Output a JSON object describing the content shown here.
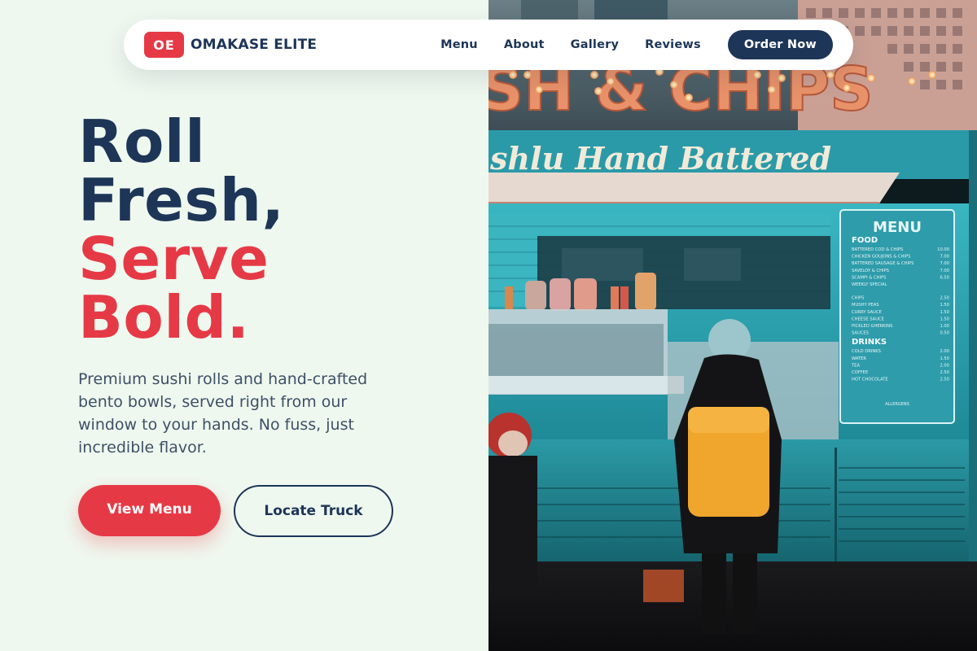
{
  "nav": {
    "logo_badge": "OE",
    "brand_name": "OMAKASE ELITE",
    "links": [
      "Menu",
      "About",
      "Gallery",
      "Reviews"
    ],
    "cta": "Order Now"
  },
  "hero": {
    "title_lines": [
      "Roll",
      "Fresh,"
    ],
    "accent_lines": [
      "Serve",
      "Bold."
    ],
    "description": "Premium sushi rolls and hand-crafted bento bowls, served right from our window to your hands. No fuss, just incredible flavor.",
    "primary_button": "View Menu",
    "secondary_button": "Locate Truck"
  },
  "photo": {
    "sign_text": "SH & CHIPS",
    "script_text": "shlu Hand Battered",
    "menu_board": {
      "title": "MENU",
      "sections": [
        {
          "heading": "FOOD",
          "items": [
            {
              "name": "BATTERED COD & CHIPS",
              "price": "10.00"
            },
            {
              "name": "CHICKEN GOUJONS & CHIPS",
              "price": "7.00"
            },
            {
              "name": "BATTERED SAUSAGE & CHIPS",
              "price": "7.00"
            },
            {
              "name": "SAVELOY & CHIPS",
              "price": "7.00"
            },
            {
              "name": "SCAMPI & CHIPS",
              "price": "6.50"
            },
            {
              "name": "WEEKLY SPECIAL",
              "price": ""
            }
          ]
        },
        {
          "heading": "",
          "items": [
            {
              "name": "CHIPS",
              "price": "2.50"
            },
            {
              "name": "MUSHY PEAS",
              "price": "1.50"
            },
            {
              "name": "CURRY SAUCE",
              "price": "1.50"
            },
            {
              "name": "CHEESE SAUCE",
              "price": "1.50"
            },
            {
              "name": "PICKLED GHERKINS",
              "price": "1.00"
            },
            {
              "name": "SAUCES",
              "price": "0.50"
            }
          ]
        },
        {
          "heading": "DRINKS",
          "items": [
            {
              "name": "COLD DRINKS",
              "price": "2.00"
            },
            {
              "name": "WATER",
              "price": "1.50"
            },
            {
              "name": "TEA",
              "price": "2.00"
            },
            {
              "name": "COFFEE",
              "price": "2.50"
            },
            {
              "name": "HOT CHOCOLATE",
              "price": "2.50"
            }
          ]
        }
      ],
      "footer": "ALLERGENS"
    }
  },
  "colors": {
    "navy": "#1d3557",
    "red": "#e63946",
    "background": "#eff8ef",
    "truck_teal": "#2ea6b4"
  }
}
